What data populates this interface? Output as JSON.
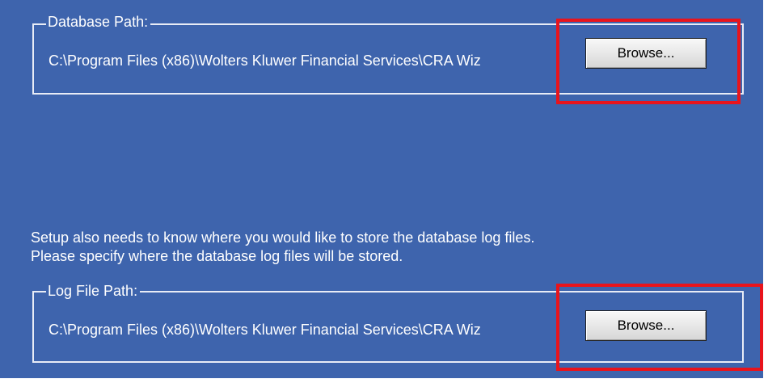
{
  "database_path": {
    "legend": "Database Path:",
    "value": "C:\\Program Files (x86)\\Wolters Kluwer Financial Services\\CRA Wiz",
    "browse_label": "Browse..."
  },
  "info_text": {
    "line1": "Setup also needs to know where you would like to store the database log files.",
    "line2": "Please specify where the database log files will be stored."
  },
  "log_file_path": {
    "legend": "Log File Path:",
    "value": "C:\\Program Files (x86)\\Wolters Kluwer Financial Services\\CRA Wiz",
    "browse_label": "Browse..."
  },
  "colors": {
    "panel_background": "#3e64ad",
    "highlight": "#e8141c"
  }
}
